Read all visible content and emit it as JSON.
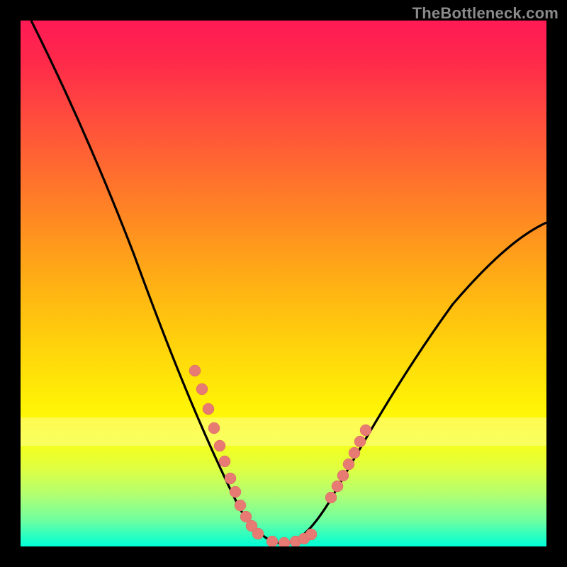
{
  "watermark": "TheBottleneck.com",
  "chart_data": {
    "type": "line",
    "title": "",
    "xlabel": "",
    "ylabel": "",
    "xlim": [
      0,
      100
    ],
    "ylim": [
      0,
      100
    ],
    "series": [
      {
        "name": "bottleneck-curve",
        "x": [
          2,
          8,
          14,
          20,
          25,
          30,
          34,
          38,
          41,
          43.5,
          45.5,
          47,
          48.5,
          50,
          52,
          54,
          56,
          58,
          60,
          64,
          70,
          78,
          88,
          100
        ],
        "values": [
          100,
          88,
          74,
          61,
          50,
          40,
          31,
          22,
          14,
          8,
          4,
          1.5,
          0.5,
          0.5,
          1,
          2.5,
          5,
          9,
          13,
          21,
          31,
          42,
          53,
          62
        ]
      }
    ],
    "markers": {
      "left_cluster": {
        "x": [
          33,
          35,
          37,
          38.5,
          40,
          41,
          42,
          43,
          44,
          45,
          46,
          50,
          51,
          52,
          53,
          54
        ],
        "values": [
          33,
          28,
          23,
          19,
          16,
          13,
          11,
          9,
          7,
          5,
          4,
          0.5,
          1,
          1.5,
          2.5,
          3
        ]
      },
      "right_cluster": {
        "x": [
          58,
          59,
          60,
          61,
          62,
          63,
          64
        ],
        "values": [
          9,
          11,
          13,
          15,
          17,
          19,
          21
        ]
      }
    },
    "gradient_stops": [
      {
        "pos": 0,
        "color": "#ff1a55"
      },
      {
        "pos": 50,
        "color": "#ffaa16"
      },
      {
        "pos": 80,
        "color": "#f7ff18"
      },
      {
        "pos": 100,
        "color": "#00ffd8"
      }
    ],
    "marker_color": "#e77b74",
    "curve_color": "#000000"
  }
}
